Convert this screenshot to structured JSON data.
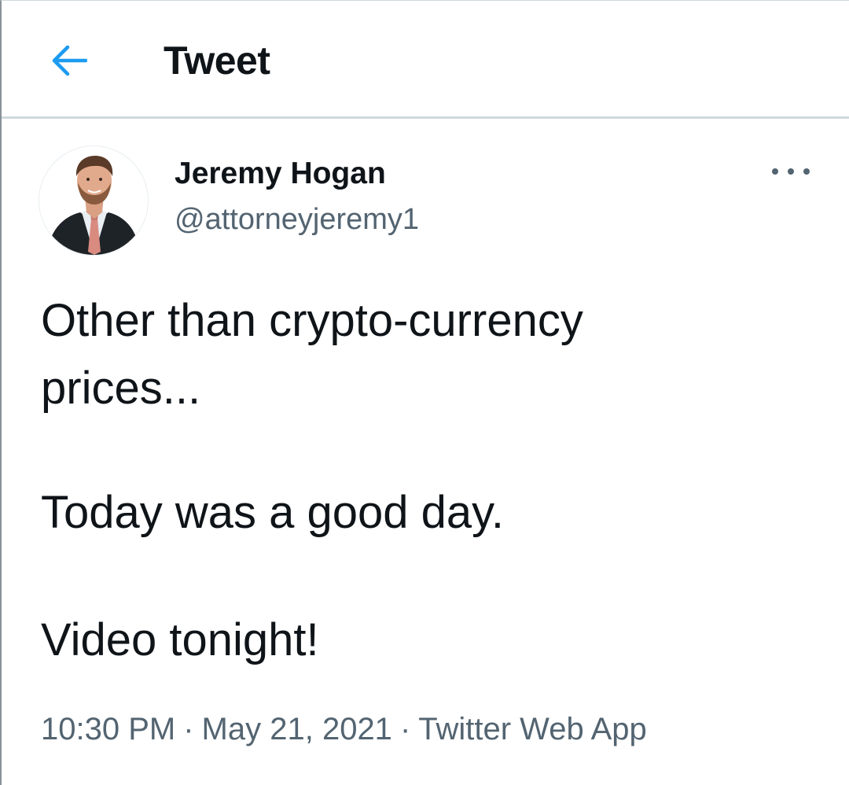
{
  "header": {
    "back_icon": "arrow-left-icon",
    "title": "Tweet",
    "accent_color": "#1d9bf0"
  },
  "tweet": {
    "author": {
      "display_name": "Jeremy Hogan",
      "handle": "@attorneyjeremy1",
      "avatar_icon": "profile-photo"
    },
    "more_icon": "more-options-icon",
    "text_lines": [
      "Other than crypto-currency",
      "prices...",
      "Today was a good day.",
      "Video tonight!"
    ],
    "time": "10:30 PM",
    "date": "May 21, 2021",
    "source": "Twitter Web App",
    "separator": "·"
  }
}
